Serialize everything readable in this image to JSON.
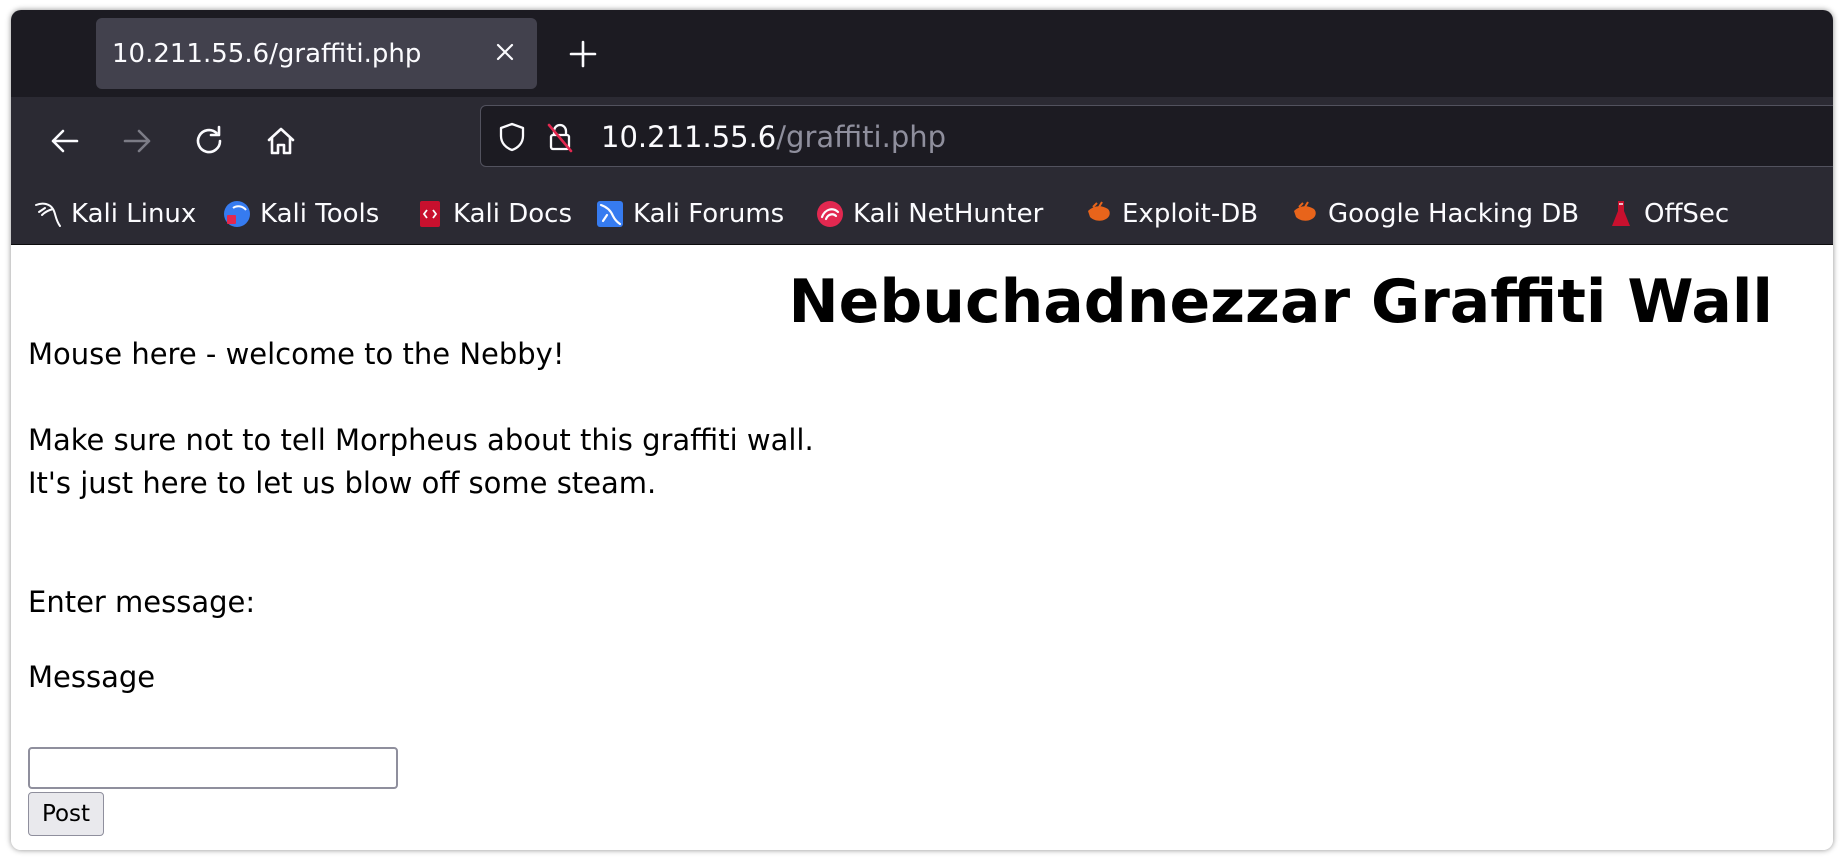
{
  "browser": {
    "tab": {
      "title": "10.211.55.6/graffiti.php",
      "close_icon": "close-icon"
    },
    "new_tab_icon": "plus-icon",
    "nav": {
      "back_icon": "arrow-left-icon",
      "forward_icon": "arrow-right-icon",
      "reload_icon": "reload-icon",
      "home_icon": "home-icon"
    },
    "url": {
      "host": "10.211.55.6",
      "path": "/graffiti.php",
      "shield_icon": "shield-icon",
      "insecure_icon": "insecure-lock-icon"
    },
    "bookmarks": [
      {
        "label": "Kali Linux",
        "icon": "kali-dragon-icon"
      },
      {
        "label": "Kali Tools",
        "icon": "kali-tools-icon"
      },
      {
        "label": "Kali Docs",
        "icon": "kali-docs-icon"
      },
      {
        "label": "Kali Forums",
        "icon": "kali-forums-icon"
      },
      {
        "label": "Kali NetHunter",
        "icon": "kali-nethunter-icon"
      },
      {
        "label": "Exploit-DB",
        "icon": "exploit-db-icon"
      },
      {
        "label": "Google Hacking DB",
        "icon": "google-hacking-db-icon"
      },
      {
        "label": "OffSec",
        "icon": "offsec-icon"
      }
    ]
  },
  "page": {
    "heading": "Nebuchadnezzar Graffiti Wall",
    "welcome": "Mouse here - welcome to the Nebby!",
    "line1": "Make sure not to tell Morpheus about this graffiti wall.",
    "line2": "It's just here to let us blow off some steam.",
    "enter_message": "Enter message:",
    "message_label": "Message",
    "message_value": "",
    "post_label": "Post"
  },
  "colors": {
    "tab_bar": "#1c1b22",
    "toolbar": "#2b2a33",
    "active_tab": "#42414d",
    "url_host": "#fbfbfe",
    "url_path": "#8f8f9d"
  }
}
